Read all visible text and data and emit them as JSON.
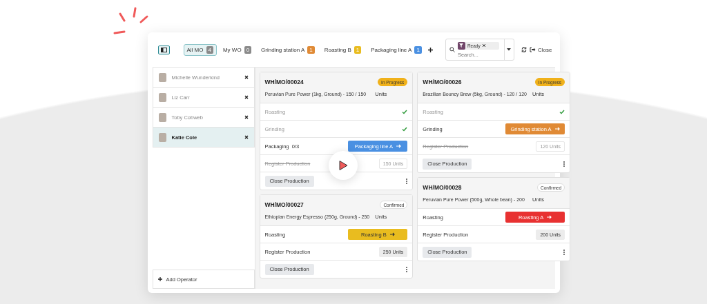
{
  "toolbar": {
    "tabs": [
      {
        "label": "All MO",
        "count": "4",
        "selected": true,
        "color": "#8a8a8a"
      },
      {
        "label": "My WO",
        "count": "0",
        "selected": false,
        "color": "#8a8a8a"
      },
      {
        "label": "Grinding station A",
        "count": "1",
        "selected": false,
        "color": "#e08a35"
      },
      {
        "label": "Roasting B",
        "count": "1",
        "selected": false,
        "color": "#e9bc1f"
      },
      {
        "label": "Packaging line A",
        "count": "1",
        "selected": false,
        "color": "#4a90e2"
      }
    ],
    "filter": {
      "facet": "Ready",
      "placeholder": "Search..."
    },
    "close": "Close"
  },
  "operators": [
    {
      "name": "Michelle Wunderkind",
      "selected": false
    },
    {
      "name": "Liz Carr",
      "selected": false
    },
    {
      "name": "Toby Cobweb",
      "selected": false
    },
    {
      "name": "Katie Cole",
      "selected": true
    }
  ],
  "add_operator": "Add Operator",
  "columns": [
    [
      {
        "ref": "WH/MO/00024",
        "status": "In Progress",
        "status_filled": true,
        "product": "Peruvian Pure Power (1kg, Ground) - 150 / 150",
        "unit": "Units",
        "rows": [
          {
            "kind": "step",
            "label": "Roasting",
            "done": true
          },
          {
            "kind": "step",
            "label": "Grinding",
            "done": true
          },
          {
            "kind": "step",
            "label": "Packaging",
            "count": "0/3",
            "done": false,
            "station": "Packaging line A",
            "color": "#4a90e2"
          },
          {
            "kind": "register",
            "label": "Register Production",
            "done": true,
            "units": "150 Units"
          }
        ],
        "close": "Close Production"
      },
      {
        "ref": "WH/MO/00027",
        "status": "Confirmed",
        "status_filled": false,
        "product": "Ethiopian Energy Espresso (250g, Ground) - 250",
        "unit": "Units",
        "rows": [
          {
            "kind": "step",
            "label": "Roasting",
            "done": false,
            "station": "Roasting B",
            "color": "#e9bc1f"
          },
          {
            "kind": "register",
            "label": "Register Production",
            "done": false,
            "units": "250 Units"
          }
        ],
        "close": "Close Production"
      }
    ],
    [
      {
        "ref": "WH/MO/00026",
        "status": "In Progress",
        "status_filled": true,
        "product": "Brazilian Bouncy Brew (5kg, Ground) - 120 / 120",
        "unit": "Units",
        "rows": [
          {
            "kind": "step",
            "label": "Roasting",
            "done": true
          },
          {
            "kind": "step",
            "label": "Grinding",
            "done": false,
            "station": "Grinding station A",
            "color": "#e08a35"
          },
          {
            "kind": "register",
            "label": "Register Production",
            "done": true,
            "units": "120 Units"
          }
        ],
        "close": "Close Production"
      },
      {
        "ref": "WH/MO/00028",
        "status": "Confirmed",
        "status_filled": false,
        "product": "Peruvian Pure Power (500g, Whole bean) - 200",
        "unit": "Units",
        "rows": [
          {
            "kind": "step",
            "label": "Roasting",
            "done": false,
            "station": "Roasting A",
            "color": "#e83131"
          },
          {
            "kind": "register",
            "label": "Register Production",
            "done": false,
            "units": "200 Units"
          }
        ],
        "close": "Close Production"
      }
    ]
  ]
}
